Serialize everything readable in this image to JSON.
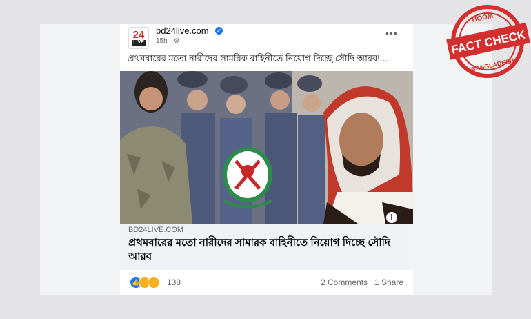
{
  "post": {
    "page_name": "bd24live.com",
    "time": "15h",
    "caption": "প্রথমবারের মতো নারীদের সামরিক বাহিনীতে নিয়োগ দিচ্ছে সৌদি আরব!...",
    "link_domain": "BD24LIVE.COM",
    "link_headline": "প্রথমবারের মতো নারীদের সামারক বাহিনীতে নিয়োগ দিচ্ছে সৌদি আরব",
    "reaction_count": "138",
    "comments": "2 Comments",
    "shares": "1 Share"
  },
  "avatar": {
    "top": "24",
    "bottom": "LIVE"
  },
  "stamp": {
    "top": "BOOM",
    "main": "FACT CHECK",
    "bottom": "BANGLADESH"
  },
  "icons": [
    "verified-icon",
    "globe-settings-icon",
    "more-options-icon",
    "info-icon",
    "like-icon",
    "sad-icon",
    "wow-icon"
  ],
  "colors": {
    "facebook_blue": "#1877f2",
    "stamp_red": "#d32f2f"
  }
}
